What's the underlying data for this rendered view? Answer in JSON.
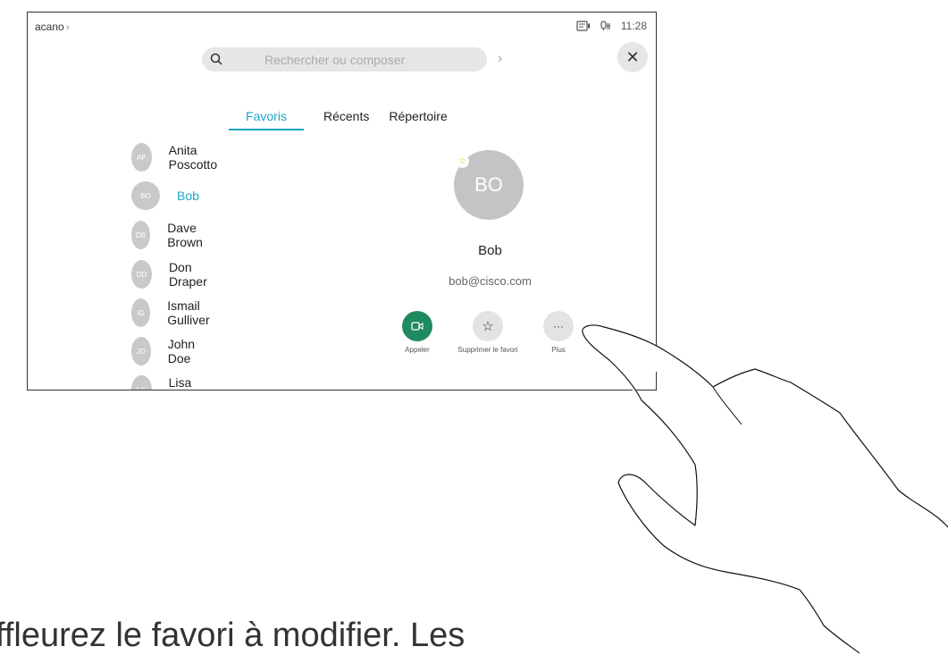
{
  "header": {
    "breadcrumb": "acano",
    "time": "11:28"
  },
  "search": {
    "placeholder": "Rechercher ou composer"
  },
  "tabs": [
    {
      "label": "Favoris",
      "active": true
    },
    {
      "label": "Récents",
      "active": false
    },
    {
      "label": "Répertoire",
      "active": false
    }
  ],
  "contacts": [
    {
      "initials": "AP",
      "name": "Anita Poscotto"
    },
    {
      "initials": "BO",
      "name": "Bob",
      "selected": true
    },
    {
      "initials": "DB",
      "name": "Dave Brown"
    },
    {
      "initials": "DD",
      "name": "Don Draper"
    },
    {
      "initials": "IG",
      "name": "Ismail Gulliver"
    },
    {
      "initials": "JD",
      "name": "John Doe"
    },
    {
      "initials": "LG",
      "name": "Lisa Green"
    }
  ],
  "detail": {
    "initials": "BO",
    "name": "Bob",
    "email": "bob@cisco.com",
    "actions": {
      "call": "Appeler",
      "remove_favorite": "Supprimer le favori",
      "more": "Plus"
    }
  },
  "caption": "ffleurez le favori à modifier. Les",
  "colors": {
    "accent": "#1ea6c9",
    "call_button": "#1f8a5e",
    "avatar": "#c9c9c9",
    "star": "#f0b400"
  }
}
